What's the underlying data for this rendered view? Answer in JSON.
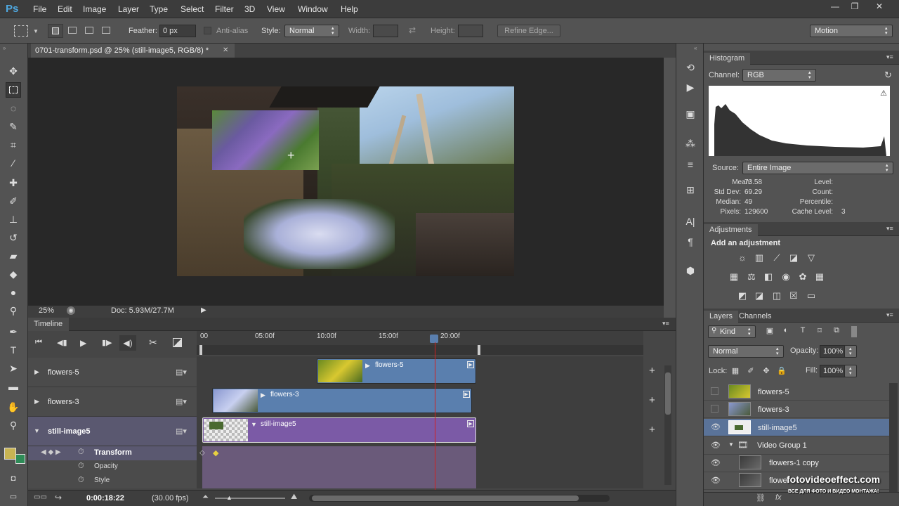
{
  "app": {
    "logo": "Ps"
  },
  "menu": [
    "File",
    "Edit",
    "Image",
    "Layer",
    "Type",
    "Select",
    "Filter",
    "3D",
    "View",
    "Window",
    "Help"
  ],
  "window_controls": [
    "—",
    "❐",
    "✕"
  ],
  "options": {
    "feather_label": "Feather:",
    "feather_value": "0 px",
    "antialias_label": "Anti-alias",
    "style_label": "Style:",
    "style_value": "Normal",
    "width_label": "Width:",
    "height_label": "Height:",
    "refine_label": "Refine Edge...",
    "workspace_value": "Motion"
  },
  "document": {
    "tab_title": "0701-transform.psd @ 25% (still-image5, RGB/8) *",
    "close": "✕"
  },
  "status": {
    "zoom": "25%",
    "doc_info": "Doc: 5.93M/27.7M"
  },
  "timeline": {
    "title": "Timeline",
    "ruler": [
      "00",
      "05:00f",
      "10:00f",
      "15:00f",
      "20:00f"
    ],
    "tracks": [
      {
        "label": "flowers-5",
        "clip": "flowers-5"
      },
      {
        "label": "flowers-3",
        "clip": "flowers-3"
      },
      {
        "label": "still-image5",
        "clip": "still-image5"
      }
    ],
    "properties": [
      "Transform",
      "Opacity",
      "Style"
    ],
    "timecode": "0:00:18:22",
    "fps": "(30.00 fps)"
  },
  "histogram": {
    "tab": "Histogram",
    "channel_label": "Channel:",
    "channel_value": "RGB",
    "source_label": "Source:",
    "source_value": "Entire Image",
    "stats_left": [
      {
        "label": "Mean:",
        "value": "73.58"
      },
      {
        "label": "Std Dev:",
        "value": "69.29"
      },
      {
        "label": "Median:",
        "value": "49"
      },
      {
        "label": "Pixels:",
        "value": "129600"
      }
    ],
    "stats_right": [
      {
        "label": "Level:",
        "value": ""
      },
      {
        "label": "Count:",
        "value": ""
      },
      {
        "label": "Percentile:",
        "value": ""
      },
      {
        "label": "Cache Level:",
        "value": "3"
      }
    ]
  },
  "adjustments": {
    "tab": "Adjustments",
    "heading": "Add an adjustment"
  },
  "layers": {
    "tabs": [
      "Layers",
      "Channels"
    ],
    "kind": "Kind",
    "blend": "Normal",
    "opacity_label": "Opacity:",
    "opacity_value": "100%",
    "lock_label": "Lock:",
    "fill_label": "Fill:",
    "fill_value": "100%",
    "items": [
      "flowers-5",
      "flowers-3",
      "still-image5",
      "Video Group 1",
      "flowers-1 copy",
      "flowers-1"
    ]
  },
  "watermark": {
    "main": "fotovideoeffect.com",
    "sub": "ВСЕ ДЛЯ ФОТО И ВИДЕО МОНТАЖА!"
  },
  "colors": {
    "accent_purple": "#7b5aa6",
    "clip_blue": "#5a7fae",
    "foreground": "#c8b453",
    "background": "#2e8b57"
  }
}
